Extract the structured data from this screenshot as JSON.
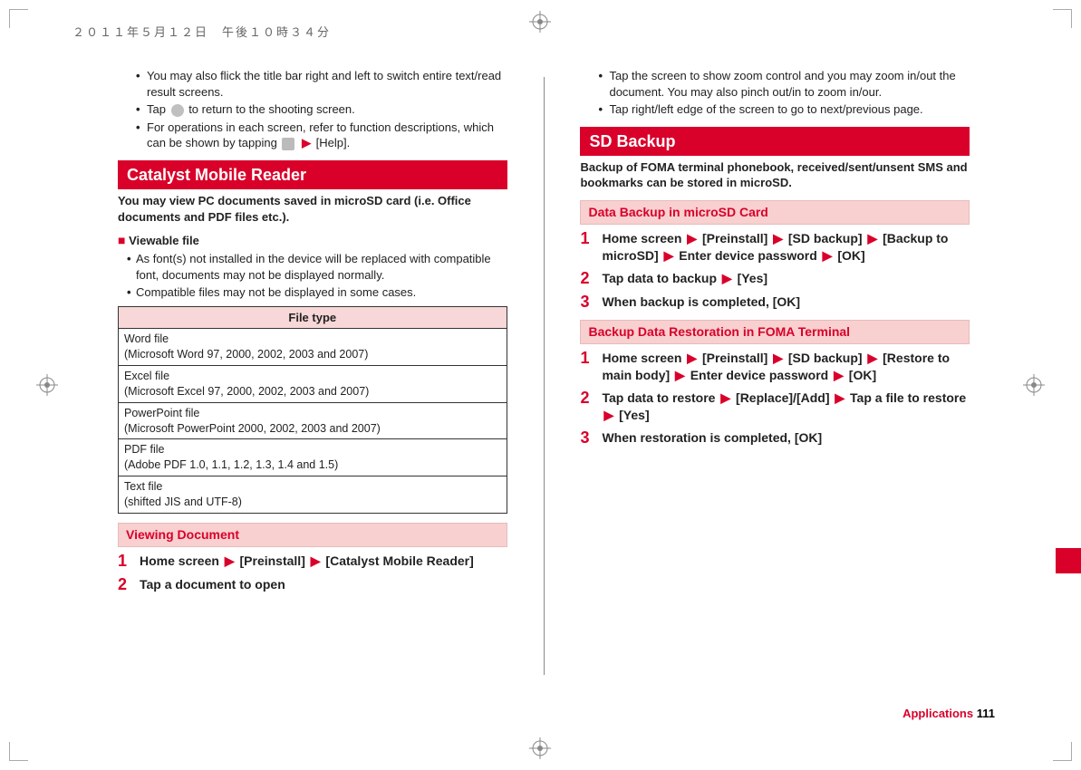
{
  "meta": {
    "datetime": "２０１１年５月１２日　午後１０時３４分"
  },
  "left": {
    "top_bullets": [
      "You may also flick the title bar right and left to switch entire text/read result screens.",
      "Tap __ICON_CIRCLE__ to return to the shooting screen.",
      "For operations in each screen, refer to function descriptions, which can be shown by tapping __ICON_SQ__ __ARROW__ [Help]."
    ],
    "section_title": "Catalyst Mobile Reader",
    "section_intro": "You may view PC documents saved in microSD card (i.e. Office documents and PDF files etc.).",
    "viewable_label": "Viewable file",
    "viewable_bullets": [
      "As font(s) not installed in the device will be replaced with compatible font, documents may not be displayed normally.",
      "Compatible files may not be displayed in some cases."
    ],
    "table_header": "File type",
    "table_rows": [
      {
        "name": "Word file",
        "detail": "(Microsoft Word 97, 2000, 2002, 2003 and 2007)"
      },
      {
        "name": "Excel file",
        "detail": "(Microsoft Excel 97, 2000, 2002, 2003 and 2007)"
      },
      {
        "name": "PowerPoint file",
        "detail": "(Microsoft PowerPoint 2000, 2002, 2003 and 2007)"
      },
      {
        "name": "PDF file",
        "detail": "(Adobe PDF 1.0, 1.1, 1.2, 1.3, 1.4 and 1.5)"
      },
      {
        "name": "Text file",
        "detail": "(shifted JIS and UTF-8)"
      }
    ],
    "sub_title": "Viewing Document",
    "steps": [
      "Home screen __ARROW__ [Preinstall] __ARROW__ [Catalyst Mobile Reader]",
      "Tap a document to open"
    ]
  },
  "right": {
    "top_bullets": [
      "Tap the screen to show zoom control and you may zoom in/out the document. You may also pinch out/in to zoom in/our.",
      "Tap right/left edge of the screen to go to next/previous page."
    ],
    "section_title": "SD Backup",
    "section_intro": "Backup of FOMA terminal phonebook, received/sent/unsent SMS and bookmarks can be stored in microSD.",
    "sub_title_a": "Data Backup in microSD Card",
    "steps_a": [
      "Home screen __ARROW__ [Preinstall] __ARROW__ [SD backup] __ARROW__ [Backup to microSD] __ARROW__ Enter device password __ARROW__ [OK]",
      "Tap data to backup __ARROW__ [Yes]",
      "When backup is completed, [OK]"
    ],
    "sub_title_b": "Backup Data Restoration in FOMA Terminal",
    "steps_b": [
      "Home screen __ARROW__ [Preinstall] __ARROW__ [SD backup] __ARROW__ [Restore to main body] __ARROW__ Enter device password __ARROW__ [OK]",
      "Tap data to restore __ARROW__ [Replace]/[Add] __ARROW__ Tap a file to restore __ARROW__ [Yes]",
      "When restoration is completed, [OK]"
    ]
  },
  "footer": {
    "category": "Applications",
    "page": "111"
  }
}
